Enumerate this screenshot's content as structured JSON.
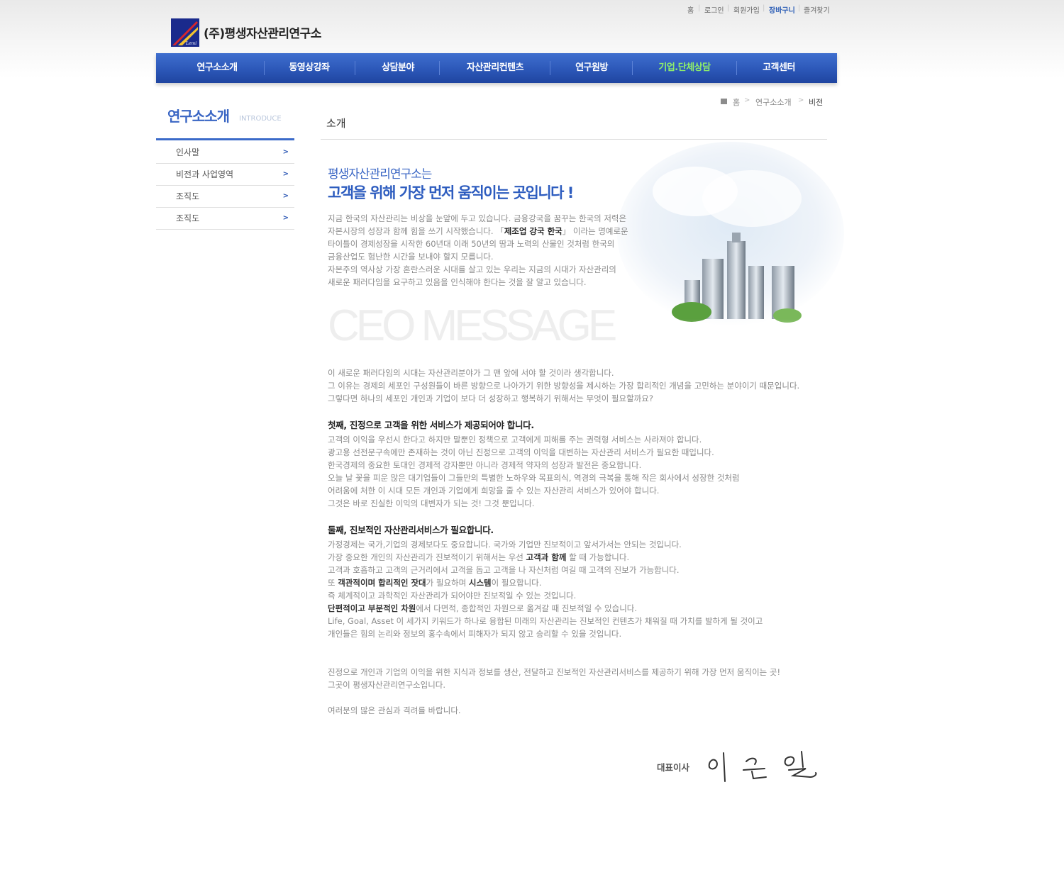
{
  "util_links": [
    "홈",
    "로그인",
    "회원가입",
    "장바구니",
    "즐겨찾기"
  ],
  "logo": {
    "mark_text": "Lemi",
    "name": "(주)평생자산관리연구소"
  },
  "gnb": [
    "연구소소개",
    "동영상강좌",
    "상담분야",
    "자산관리컨텐츠",
    "연구원방",
    "기업.단체상담",
    "고객센터"
  ],
  "gnb_active_color": "#8fef6a",
  "brand_color": "#2d5cbf",
  "breadcrumb": [
    "홈",
    "연구소소개",
    "비전"
  ],
  "lnb": {
    "title": "연구소소개",
    "subtitle": "INTRODUCE",
    "items": [
      "인사말",
      "비전과 사업영역",
      "조직도",
      "조직도"
    ]
  },
  "page_title": "소개",
  "hero": {
    "sub": "평생자산관리연구소는",
    "main": "고객을 위해 가장 먼저 움직이는 곳입니다 !"
  },
  "intro": {
    "l1": "지금 한국의 자산관리는 비상을 눈앞에 두고 있습니다. 금융강국을 꿈꾸는 한국의 저력은",
    "l2a": "자본시장의 성장과 함께 힘을 쓰기 시작했습니다.  「",
    "l2b": "제조업 강국 한국",
    "l2c": "」 이라는 명예로운",
    "l3": "타이틀이 경제성장을 시작한 60년대 이래 50년의 땀과 노력의 산물인 것처럼 한국의",
    "l4": "금융산업도 험난한 시간을 보내야 할지 모릅니다.",
    "l5": " 자본주의 역사상 가장 혼란스러운 시대를 살고 있는 우리는 지금의 시대가 자산관리의",
    "l6": "새로운 패러다임을 요구하고 있음을 인식해야 한다는 것을 잘 알고 있습니다."
  },
  "ceo_message": "CEO MESSAGE",
  "para1": [
    "이 새로운 패러다임의 시대는 자산관리분야가 그 맨 앞에 서야 할 것이라 생각합니다.",
    "그 이유는 경제의 세포인 구성원들이 바른 방향으로 나아가기 위한 방향성을 제시하는 가장 합리적인 개념을 고민하는 분야이기 때문입니다.",
    "그렇다면 하나의 세포인 개인과 기업이 보다 더 성장하고 행복하기 위해서는 무엇이 필요할까요?"
  ],
  "section1": {
    "heading": "첫째, 진정으로 고객을 위한 서비스가 제공되어야 합니다.",
    "lines": [
      "고객의 이익을 우선시 한다고 하지만 말뿐인 정책으로 고객에게 피해를 주는 권력형 서비스는 사라져야  합니다.",
      "광고용 선전문구속에만 존재하는 것이 아닌 진정으로 고객의 이익을 대변하는 자산관리 서비스가 필요한 때입니다.",
      "한국경제의 중요한 토대인 경제적 강자뿐만 아니라 경제적 약자의 성장과 발전은 중요합니다.",
      "오늘 날 꽃을 피운 많은 대기업들이 그들만의 특별한 노하우와 목표의식, 역경의 극복을 통해 작은 회사에서 성장한 것처럼",
      "어려움에 처한 이 시대 모든 개인과 기업에게 희망을 줄 수 있는 자산관리 서비스가 있어야 합니다.",
      "그것은 바로 진실한 이익의 대변자가 되는 것! 그것 뿐입니다."
    ]
  },
  "section2": {
    "heading": "둘째, 진보적인 자산관리서비스가 필요합니다.",
    "l1": "가정경제는 국가,기업의 경제보다도 중요합니다. 국가와 기업만 진보적이고 앞서가서는 안되는 것입니다.",
    "l2a": "가장 중요한 개인의 자산관리가 진보적이기 위해서는 우선 ",
    "l2b": "고객과 함께",
    "l2c": " 할 때 가능합니다.",
    "l3": "고객과 호흡하고 고객의 근거리에서 고객을 돕고 고객을 나 자신처럼 여길 때 고객의 진보가 가능합니다.",
    "l4a": "또 ",
    "l4b": "객관적이며 합리적인 잣대",
    "l4c": "가 필요하며 ",
    "l4d": "시스템",
    "l4e": "이 필요합니다.",
    "l5": "즉 체계적이고 과학적인 자산관리가 되어야만 진보적일 수 있는 것입니다.",
    "l6a": "단편적이고 부분적인 차원",
    "l6b": "에서 다면적, 종합적인 차원으로 옮겨갈 때 진보적일 수 있습니다.",
    "l7": "Life, Goal, Asset 이 세가지 키워드가 하나로 융합된 미래의 자산관리는 진보적인 컨텐츠가 채워질 때 가치를 발하게 될 것이고",
    "l8": "개인들은 힘의 논리와 정보의 홍수속에서 피해자가 되지 않고 승리할 수 있을 것입니다."
  },
  "closing": [
    "진정으로 개인과 기업의 이익을 위한 지식과 정보를 생산, 전달하고 진보적인 자산관리서비스를 제공하기 위해 가장 먼저 움직이는 곳!",
    "그곳이 평생자산관리연구소입니다."
  ],
  "thanks": "여러분의 많은 관심과 격려를 바랍니다.",
  "signer_title": "대표이사"
}
